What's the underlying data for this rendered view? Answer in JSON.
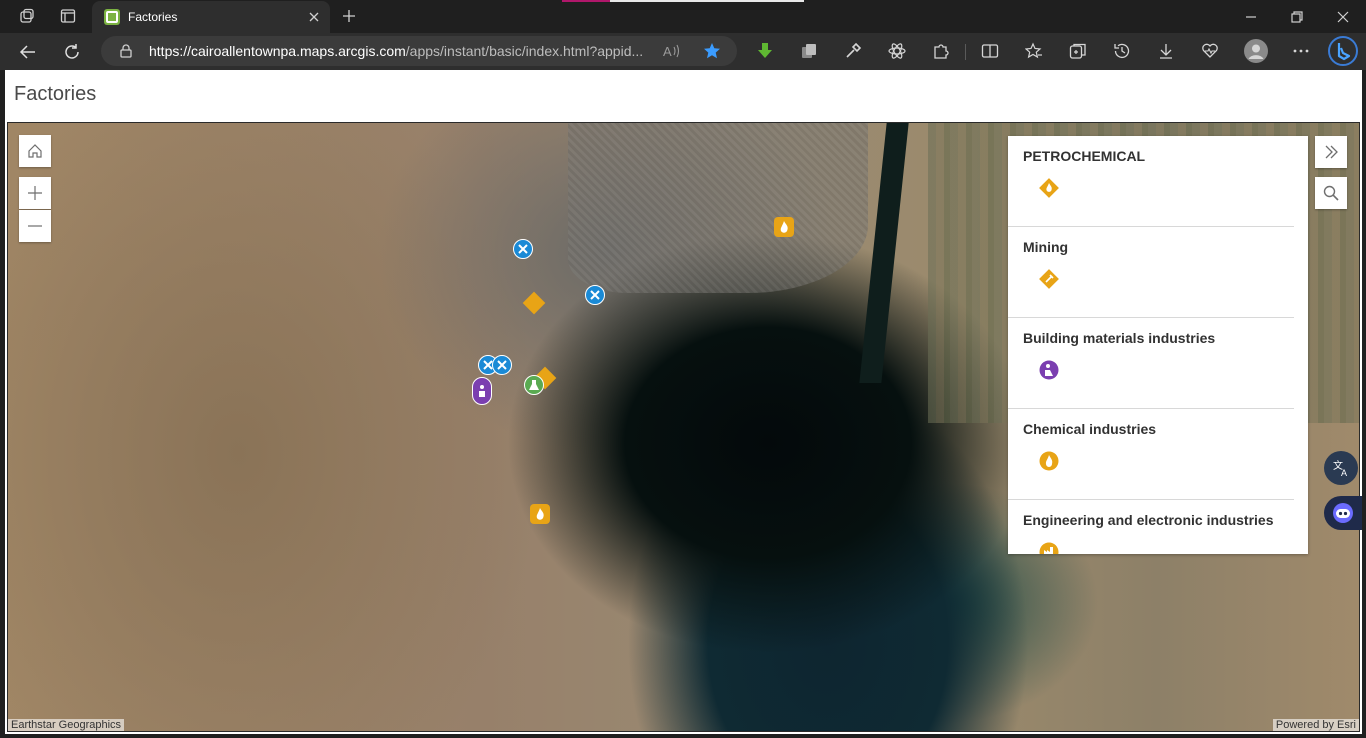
{
  "browser": {
    "tab_title": "Factories",
    "url_host": "https://cairoallentownpa.maps.arcgis.com",
    "url_path": "/apps/instant/basic/index.html?appid...",
    "colors": {
      "chrome_bg": "#1f1f1f",
      "toolbar_bg": "#2e2e2e",
      "favorite_star": "#3b9cff"
    }
  },
  "icons": {
    "tab_actions": "tab-actions-icon",
    "vertical_tabs": "vertical-tabs-icon",
    "tab_close": "close-icon",
    "new_tab": "plus-icon",
    "minimize": "minimize-icon",
    "restore": "restore-icon",
    "window_close": "close-icon",
    "back": "back-arrow-icon",
    "refresh": "refresh-icon",
    "lock": "lock-icon",
    "read_aloud": "read-aloud-icon",
    "favorite": "star-icon",
    "extensions": [
      "download-extension-icon",
      "collections-ext-icon",
      "eyedropper-icon",
      "atom-icon",
      "puzzle-icon"
    ],
    "split_screen": "split-screen-icon",
    "favorites": "favorites-icon",
    "collections": "collections-icon",
    "history": "history-icon",
    "downloads": "download-icon",
    "performance": "heartbeat-icon",
    "profile": "profile-avatar-icon",
    "more": "ellipsis-icon",
    "copilot": "bing-copilot-icon"
  },
  "app": {
    "title": "Factories"
  },
  "map": {
    "controls": {
      "home": "home-icon",
      "zoom_in": "plus-icon",
      "zoom_out": "minus-icon",
      "expand": "double-chevron-right-icon",
      "search": "search-icon"
    },
    "attribution_left": "Earthstar Geographics",
    "attribution_right": "Powered by Esri",
    "marker_colors": {
      "tools": "#1a8ad6",
      "mining": "#e8a416",
      "building": "#7b3fb0",
      "chemical": "#5aaa52"
    }
  },
  "legend": {
    "items": [
      {
        "label": "PETROCHEMICAL",
        "symbol": "flame-diamond-icon",
        "color": "#e8a416"
      },
      {
        "label": "Mining",
        "symbol": "pickaxe-diamond-icon",
        "color": "#e8a416"
      },
      {
        "label": "Building materials industries",
        "symbol": "worker-circle-icon",
        "color": "#7b3fb0"
      },
      {
        "label": "Chemical industries",
        "symbol": "flame-circle-icon",
        "color": "#e8a416"
      },
      {
        "label": "Engineering and electronic industries",
        "symbol": "factory-circle-icon",
        "color": "#e8a416"
      }
    ]
  },
  "floating": {
    "translate": "translate-icon",
    "assistant": "assistant-bot-icon"
  }
}
